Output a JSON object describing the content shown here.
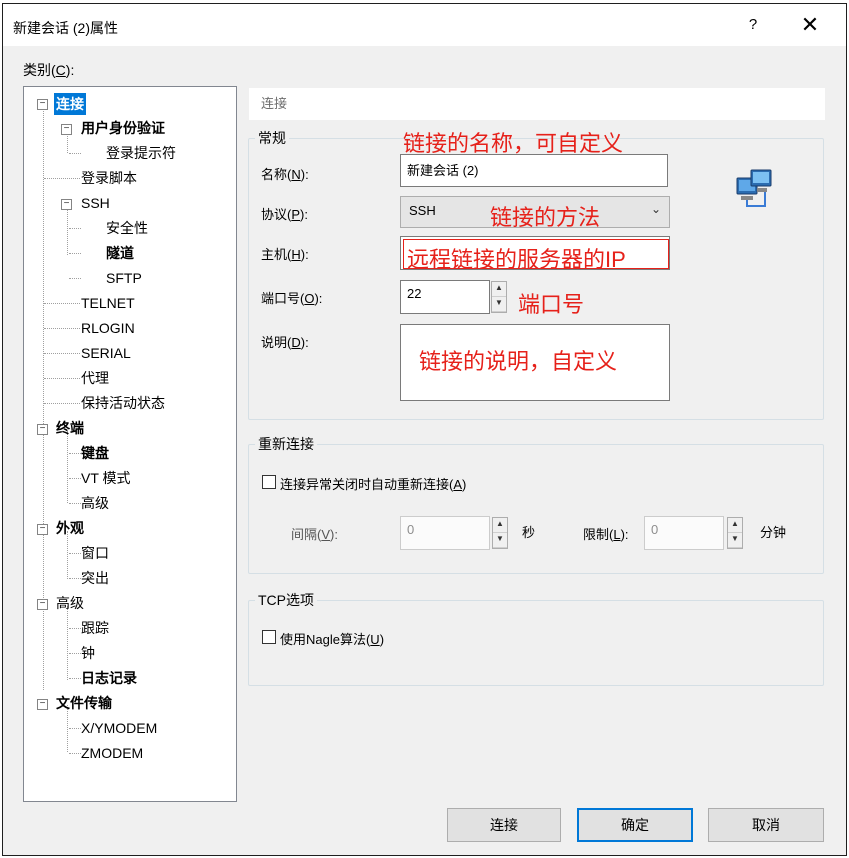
{
  "window": {
    "title": "新建会话 (2)属性",
    "help_label": "?",
    "close_label": "✕"
  },
  "category": {
    "label": "类别(",
    "mnemonic": "C",
    "suffix": "):"
  },
  "tree": [
    {
      "label": "连接",
      "selected": true
    },
    {
      "label": "用户身份验证"
    },
    {
      "label": "登录提示符"
    },
    {
      "label": "登录脚本"
    },
    {
      "label": "SSH"
    },
    {
      "label": "安全性"
    },
    {
      "label": "隧道"
    },
    {
      "label": "SFTP"
    },
    {
      "label": "TELNET"
    },
    {
      "label": "RLOGIN"
    },
    {
      "label": "SERIAL"
    },
    {
      "label": "代理"
    },
    {
      "label": "保持活动状态"
    },
    {
      "label": "终端"
    },
    {
      "label": "键盘"
    },
    {
      "label": "VT 模式"
    },
    {
      "label": "高级"
    },
    {
      "label": "外观"
    },
    {
      "label": "窗口"
    },
    {
      "label": "突出"
    },
    {
      "label": "高级"
    },
    {
      "label": "跟踪"
    },
    {
      "label": "钟"
    },
    {
      "label": "日志记录"
    },
    {
      "label": "文件传输"
    },
    {
      "label": "X/YMODEM"
    },
    {
      "label": "ZMODEM"
    }
  ],
  "page_header": "连接",
  "general": {
    "title": "常规",
    "name_label": [
      "名称(",
      "N",
      "):"
    ],
    "name_value": "新建会话 (2)",
    "protocol_label": [
      "协议(",
      "P",
      "):"
    ],
    "protocol_value": "SSH",
    "host_label": [
      "主机(",
      "H",
      "):"
    ],
    "host_value": "",
    "port_label": [
      "端口号(",
      "O",
      "):"
    ],
    "port_value": "22",
    "desc_label": [
      "说明(",
      "D",
      "):"
    ],
    "desc_value": ""
  },
  "annotations": {
    "name": "链接的名称，可自定义",
    "protocol": "链接的方法",
    "host": "远程链接的服务器的IP",
    "port": "端口号",
    "desc": "链接的说明，自定义"
  },
  "reconnect": {
    "title": "重新连接",
    "checkbox_label": [
      "连接异常关闭时自动重新连接(",
      "A",
      ")"
    ],
    "interval_label": [
      "间隔(",
      "V",
      "):"
    ],
    "interval_value": "0",
    "interval_unit": "秒",
    "limit_label": [
      "限制(",
      "L",
      "):"
    ],
    "limit_value": "0",
    "limit_unit": "分钟"
  },
  "tcp": {
    "title": "TCP选项",
    "nagle_label": [
      "使用Nagle算法(",
      "U",
      ")"
    ]
  },
  "buttons": {
    "connect": "连接",
    "ok": "确定",
    "cancel": "取消"
  },
  "icons": {
    "network": "network-computer-icon",
    "spin_up": "▲",
    "spin_down": "▼",
    "combo_arrow": "⌄",
    "collapse": "−"
  },
  "colors": {
    "selection": "#0078d7",
    "annotation": "#e6211a"
  }
}
